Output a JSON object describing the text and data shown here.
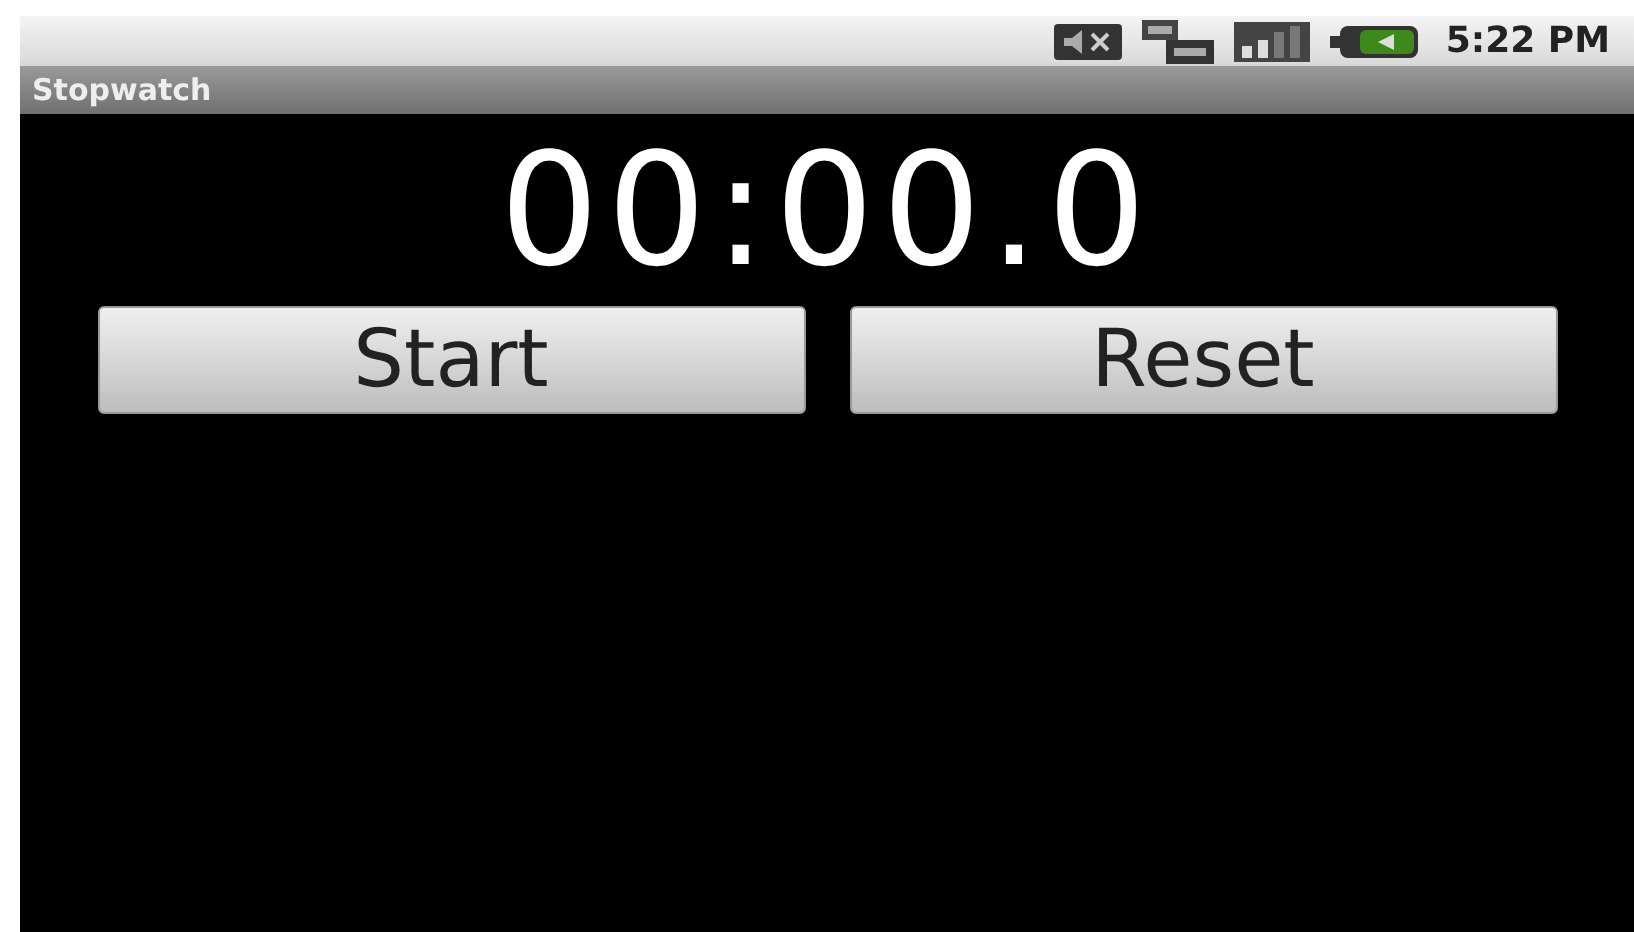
{
  "status_bar": {
    "time": "5:22 PM"
  },
  "title_bar": {
    "title": "Stopwatch"
  },
  "display": {
    "time": "00:00.0"
  },
  "buttons": [
    {
      "label": "Start"
    },
    {
      "label": "Reset"
    }
  ]
}
